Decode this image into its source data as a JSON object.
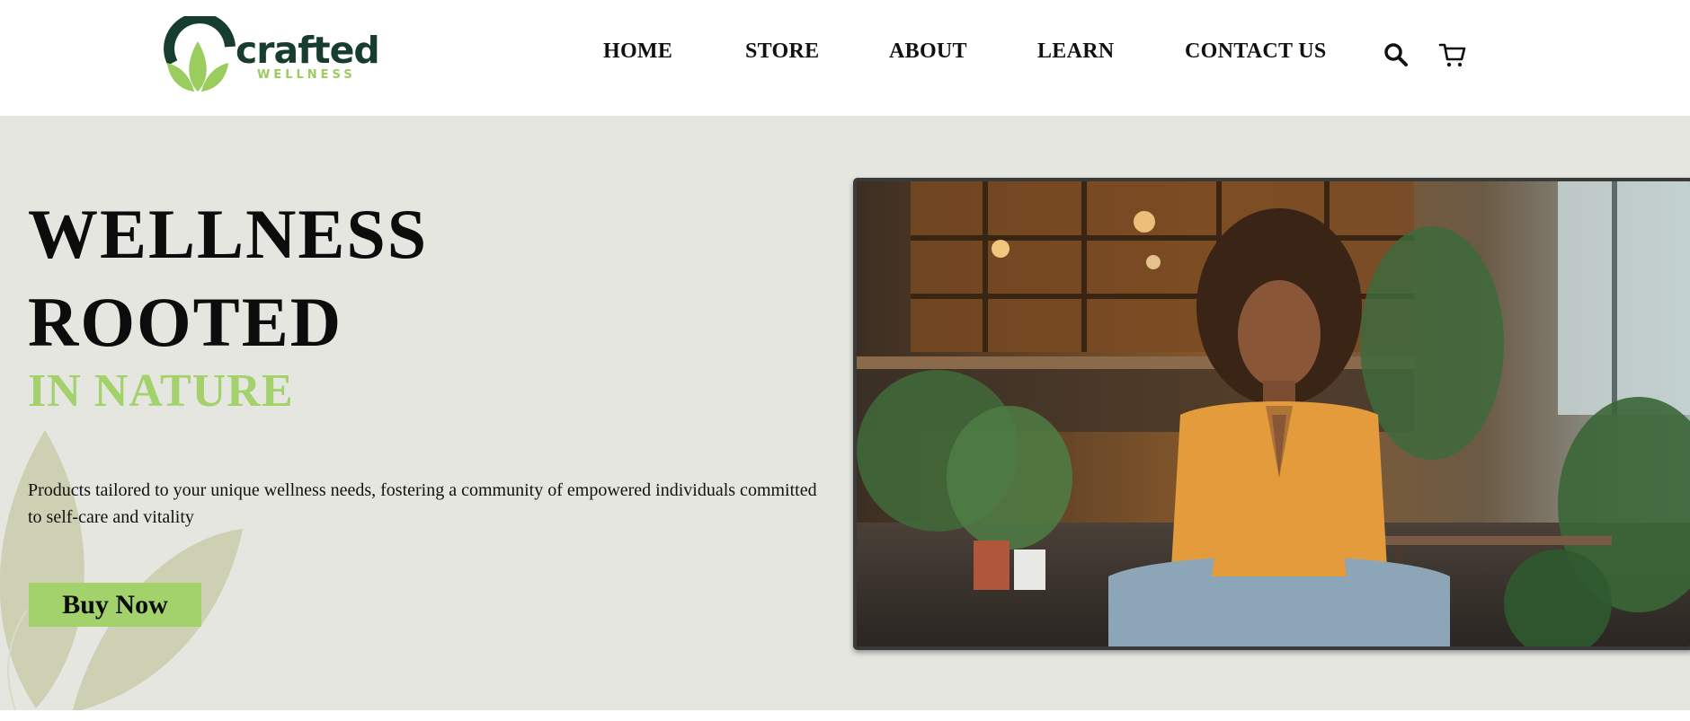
{
  "brand": {
    "name": "crafted",
    "tagline": "WELLNESS",
    "primary_color": "#173d2f",
    "accent_color": "#a3d16c"
  },
  "nav": {
    "items": [
      {
        "label": "HOME"
      },
      {
        "label": "STORE"
      },
      {
        "label": "ABOUT"
      },
      {
        "label": "LEARN"
      },
      {
        "label": "CONTACT US"
      }
    ],
    "search_icon": "search-icon",
    "cart_icon": "cart-icon"
  },
  "hero": {
    "title_line_1": "WELLNESS",
    "title_line_2": "ROOTED",
    "title_line_3": "IN NATURE",
    "description": "Products tailored to your unique wellness needs, fostering a community of empowered individuals committed to self-care and vitality",
    "cta_label": "Buy Now",
    "background_color": "#e6e6e0"
  }
}
